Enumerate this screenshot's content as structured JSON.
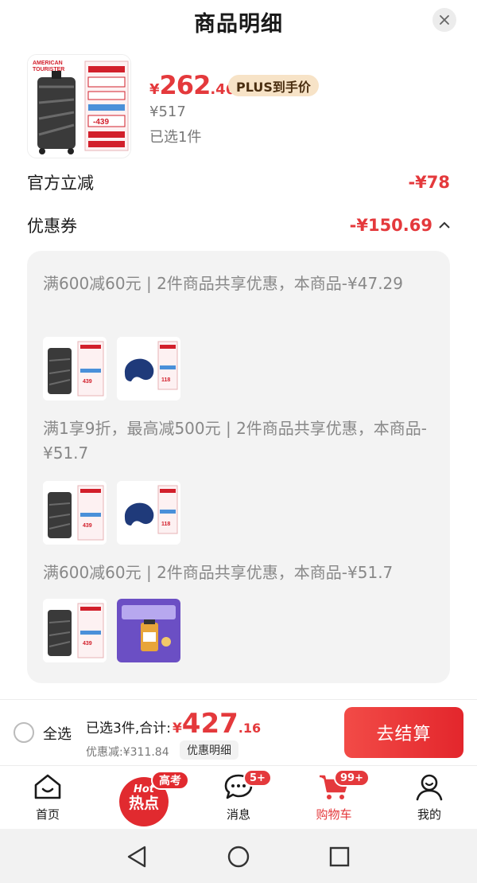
{
  "header": {
    "title": "商品明细"
  },
  "product": {
    "currency": "¥",
    "price_int": "262",
    "price_dec": ".46",
    "plus_tag": "PLUS到手价",
    "original_price": "¥517",
    "selected": "已选1件"
  },
  "discounts": {
    "official": {
      "label": "官方立减",
      "value": "-¥78"
    },
    "coupon": {
      "label": "优惠券",
      "value": "-¥150.69"
    },
    "items": [
      {
        "desc": "满600减60元 | 2件商品共享优惠，本商品-¥47.29"
      },
      {
        "desc": "满1享9折，最高减500元 | 2件商品共享优惠，本商品-¥51.7"
      },
      {
        "desc": "满600减60元 | 2件商品共享优惠，本商品-¥51.7"
      }
    ]
  },
  "checkout": {
    "select_all": "全选",
    "total_label": "已选3件,合计:",
    "total_yen": "¥",
    "total_int": "427",
    "total_dec": ".16",
    "discount_total": "优惠减:¥311.84",
    "detail_button": "优惠明细",
    "pay_button": "去结算"
  },
  "tabs": [
    {
      "label": "首页",
      "icon": "home-icon"
    },
    {
      "label": "热点",
      "icon": "hot-icon",
      "badge": "高考",
      "hot_top": "Hot"
    },
    {
      "label": "消息",
      "icon": "message-icon",
      "badge": "5+"
    },
    {
      "label": "购物车",
      "icon": "cart-icon",
      "badge": "99+",
      "active": true
    },
    {
      "label": "我的",
      "icon": "profile-icon"
    }
  ],
  "colors": {
    "accent": "#e4393c",
    "plus_bg": "#f7e3c7"
  }
}
